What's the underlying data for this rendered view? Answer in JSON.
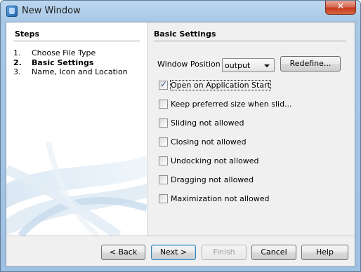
{
  "window": {
    "title": "New Window",
    "close_glyph": "✕"
  },
  "steps": {
    "header": "Steps",
    "items": [
      {
        "num": "1.",
        "label": "Choose File Type"
      },
      {
        "num": "2.",
        "label": "Basic Settings"
      },
      {
        "num": "3.",
        "label": "Name, Icon and Location"
      }
    ],
    "current_index": 1
  },
  "settings": {
    "header": "Basic Settings",
    "window_position_label": "Window Position :",
    "window_position_value": "output",
    "redefine_label": "Redefine...",
    "checkboxes": [
      {
        "label": "Open on Application Start",
        "checked": true,
        "focused": true
      },
      {
        "label": "Keep preferred size when slid...",
        "checked": false
      },
      {
        "label": "Sliding not allowed",
        "checked": false
      },
      {
        "label": "Closing not allowed",
        "checked": false
      },
      {
        "label": "Undocking not allowed",
        "checked": false
      },
      {
        "label": "Dragging not allowed",
        "checked": false
      },
      {
        "label": "Maximization not allowed",
        "checked": false
      }
    ]
  },
  "footer": {
    "back_label": "< Back",
    "next_label": "Next >",
    "finish_label": "Finish",
    "cancel_label": "Cancel",
    "help_label": "Help"
  },
  "icons": {
    "title": "window-app-icon",
    "close": "close-icon",
    "dropdown": "chevron-down-icon",
    "check": "checkmark-icon"
  }
}
